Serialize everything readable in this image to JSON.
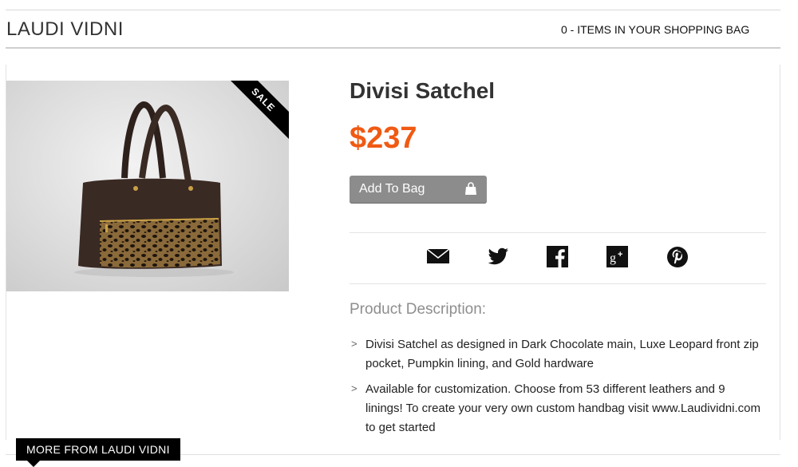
{
  "header": {
    "brand": "LAUDI VIDNI",
    "bag_count_text": "0 - ITEMS IN YOUR SHOPPING BAG"
  },
  "product": {
    "title": "Divisi Satchel",
    "price": "$237",
    "sale_badge": "SALE",
    "add_to_bag_label": "Add To Bag",
    "image_subject": "dark-chocolate-leather-satchel-with-leopard-pocket"
  },
  "share": {
    "icons": [
      "email-icon",
      "twitter-icon",
      "facebook-icon",
      "google-plus-icon",
      "pinterest-icon"
    ]
  },
  "description": {
    "heading": "Product Description:",
    "bullet_glyph": ">",
    "items": [
      "Divisi Satchel as designed in Dark Chocolate main, Luxe Leopard front zip pocket, Pumpkin lining, and Gold hardware",
      "Available for customization. Choose from 53 different leathers and 9 linings! To create your very own custom handbag visit www.Laudividni.com to get started"
    ]
  },
  "footer_tab": {
    "label": "MORE FROM LAUDI VIDNI"
  },
  "colors": {
    "price": "#f05a13",
    "button": "#8c8c8c",
    "bag": "#3a2a24"
  }
}
